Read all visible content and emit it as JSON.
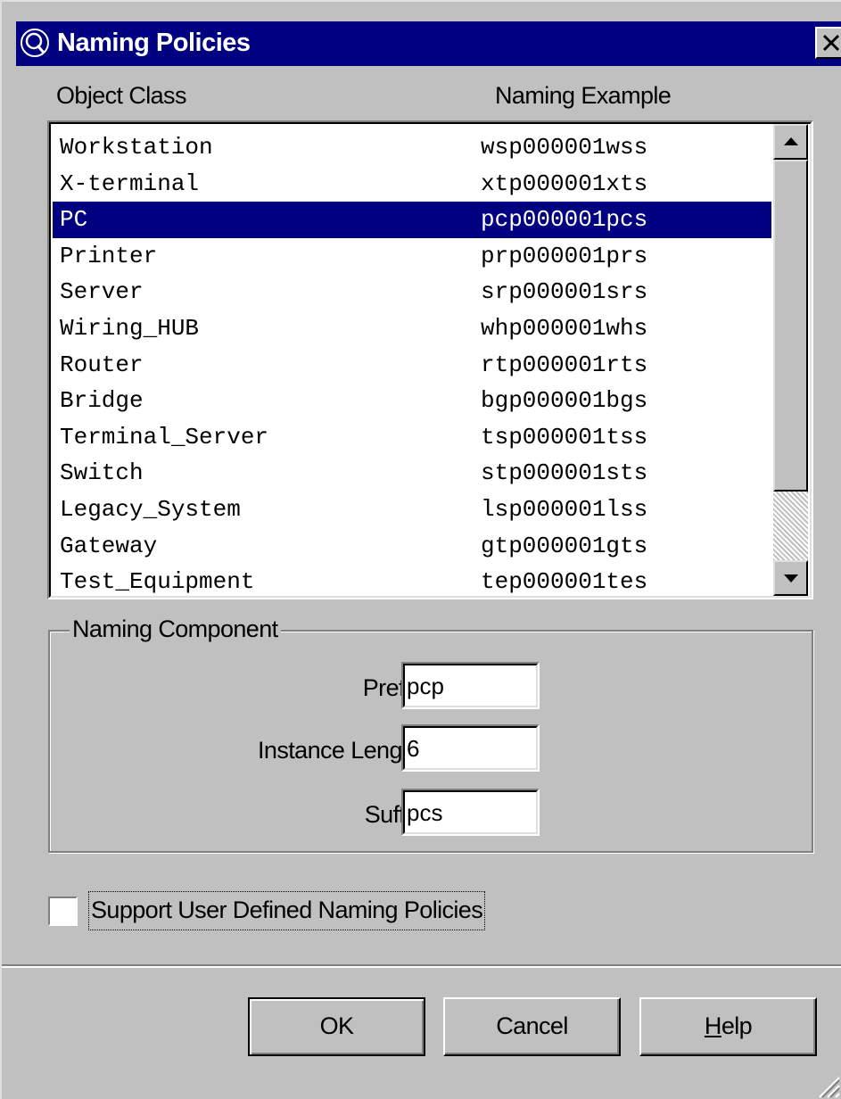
{
  "window": {
    "title": "Naming Policies",
    "icon": "app-icon",
    "close_icon": "close-icon"
  },
  "list": {
    "headers": {
      "object_class": "Object Class",
      "naming_example": "Naming Example"
    },
    "rows": [
      {
        "object_class": "Workstation",
        "naming_example": "wsp000001wss"
      },
      {
        "object_class": "X-terminal",
        "naming_example": "xtp000001xts"
      },
      {
        "object_class": "PC",
        "naming_example": "pcp000001pcs",
        "selected": true
      },
      {
        "object_class": "Printer",
        "naming_example": "prp000001prs"
      },
      {
        "object_class": "Server",
        "naming_example": "srp000001srs"
      },
      {
        "object_class": "Wiring_HUB",
        "naming_example": "whp000001whs"
      },
      {
        "object_class": "Router",
        "naming_example": "rtp000001rts"
      },
      {
        "object_class": "Bridge",
        "naming_example": "bgp000001bgs"
      },
      {
        "object_class": "Terminal_Server",
        "naming_example": "tsp000001tss"
      },
      {
        "object_class": "Switch",
        "naming_example": "stp000001sts"
      },
      {
        "object_class": "Legacy_System",
        "naming_example": "lsp000001lss"
      },
      {
        "object_class": "Gateway",
        "naming_example": "gtp000001gts"
      },
      {
        "object_class": "Test_Equipment",
        "naming_example": "tep000001tes"
      }
    ],
    "selection_color": "#000080"
  },
  "naming_component": {
    "legend": "Naming Component",
    "prefix_label": "Prefix :",
    "prefix_value": "pcp",
    "instance_length_label": "Instance Length :",
    "instance_length_value": "6",
    "suffix_label": "Suffix :",
    "suffix_value": "pcs"
  },
  "options": {
    "support_user_defined_label": "Support User Defined Naming Policies",
    "support_user_defined_checked": false
  },
  "buttons": {
    "ok": "OK",
    "cancel": "Cancel",
    "help_mnemonic": "H",
    "help_rest": "elp"
  }
}
